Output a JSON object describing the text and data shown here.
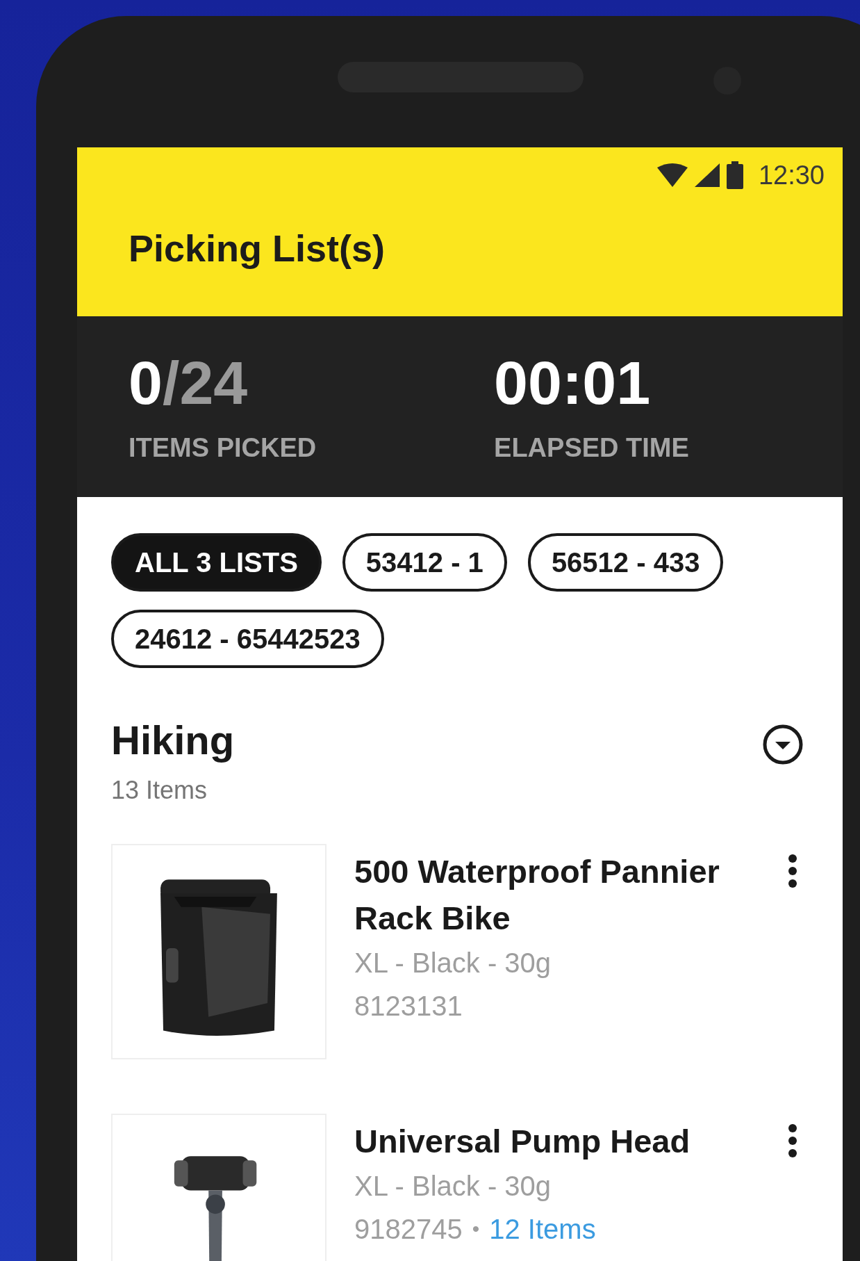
{
  "status_bar": {
    "time": "12:30"
  },
  "app_bar": {
    "title": "Picking List(s)"
  },
  "stats": [
    {
      "value": "0",
      "total": "/24",
      "label": "ITEMS PICKED"
    },
    {
      "value": "00:01",
      "label": "ELAPSED TIME"
    }
  ],
  "filters": [
    {
      "label": "ALL 3 LISTS",
      "selected": true
    },
    {
      "label": "53412 - 1",
      "selected": false
    },
    {
      "label": "56512 - 433",
      "selected": false
    },
    {
      "label": "24612 - 65442523",
      "selected": false
    }
  ],
  "section": {
    "title": "Hiking",
    "count": "13 Items"
  },
  "items": [
    {
      "title": "500 Waterproof Pannier Rack Bike",
      "variant": "XL - Black - 30g",
      "sku": "8123131"
    },
    {
      "title": "Universal Pump Head",
      "variant": "XL - Black - 30g",
      "sku": "9182745",
      "separator": "•",
      "link": "12 Items"
    }
  ]
}
